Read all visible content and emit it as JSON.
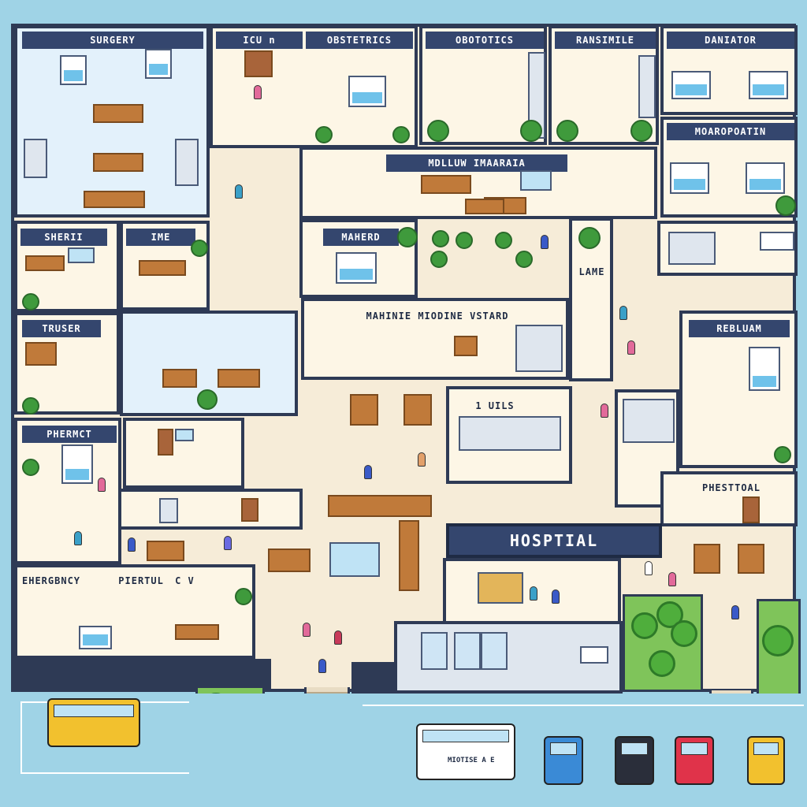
{
  "rooms": {
    "surgery": "SURGERY",
    "icu": "ICU",
    "icu_mark": "n",
    "obstetrics": "OBSTETRICS",
    "orthotics": "OBOTOTICS",
    "radiology": "RANSIMILE",
    "dialysis": "DANIATOR",
    "maternity": "MOAROPOATIN",
    "sheri": "SHERII",
    "ime": "IME",
    "pathology_top": "MDLLUW IMAARAIA",
    "ward_center": "MAHERD",
    "lame": "LAME",
    "machine_hall": "MAHINIE MIODINE VSTARD",
    "truck": "TRUSER",
    "research": "REBLUAM",
    "labs": "1 UILS",
    "pharmacy": "PHERMCT",
    "phestool": "PHESTTOAL",
    "emergency": "EHERGBNCY",
    "emergency_sub": "PIERTUL",
    "emergency_mark": "C V"
  },
  "main_sign": "HOSPTIAL",
  "vehicles": {
    "ambulance_text": "MIOTISE A E"
  },
  "colors": {
    "wall": "#2e3a55",
    "label_bg": "#34466e",
    "floor": "#f6ecd8",
    "sky": "#9fd3e6",
    "grass": "#7fc45a"
  }
}
